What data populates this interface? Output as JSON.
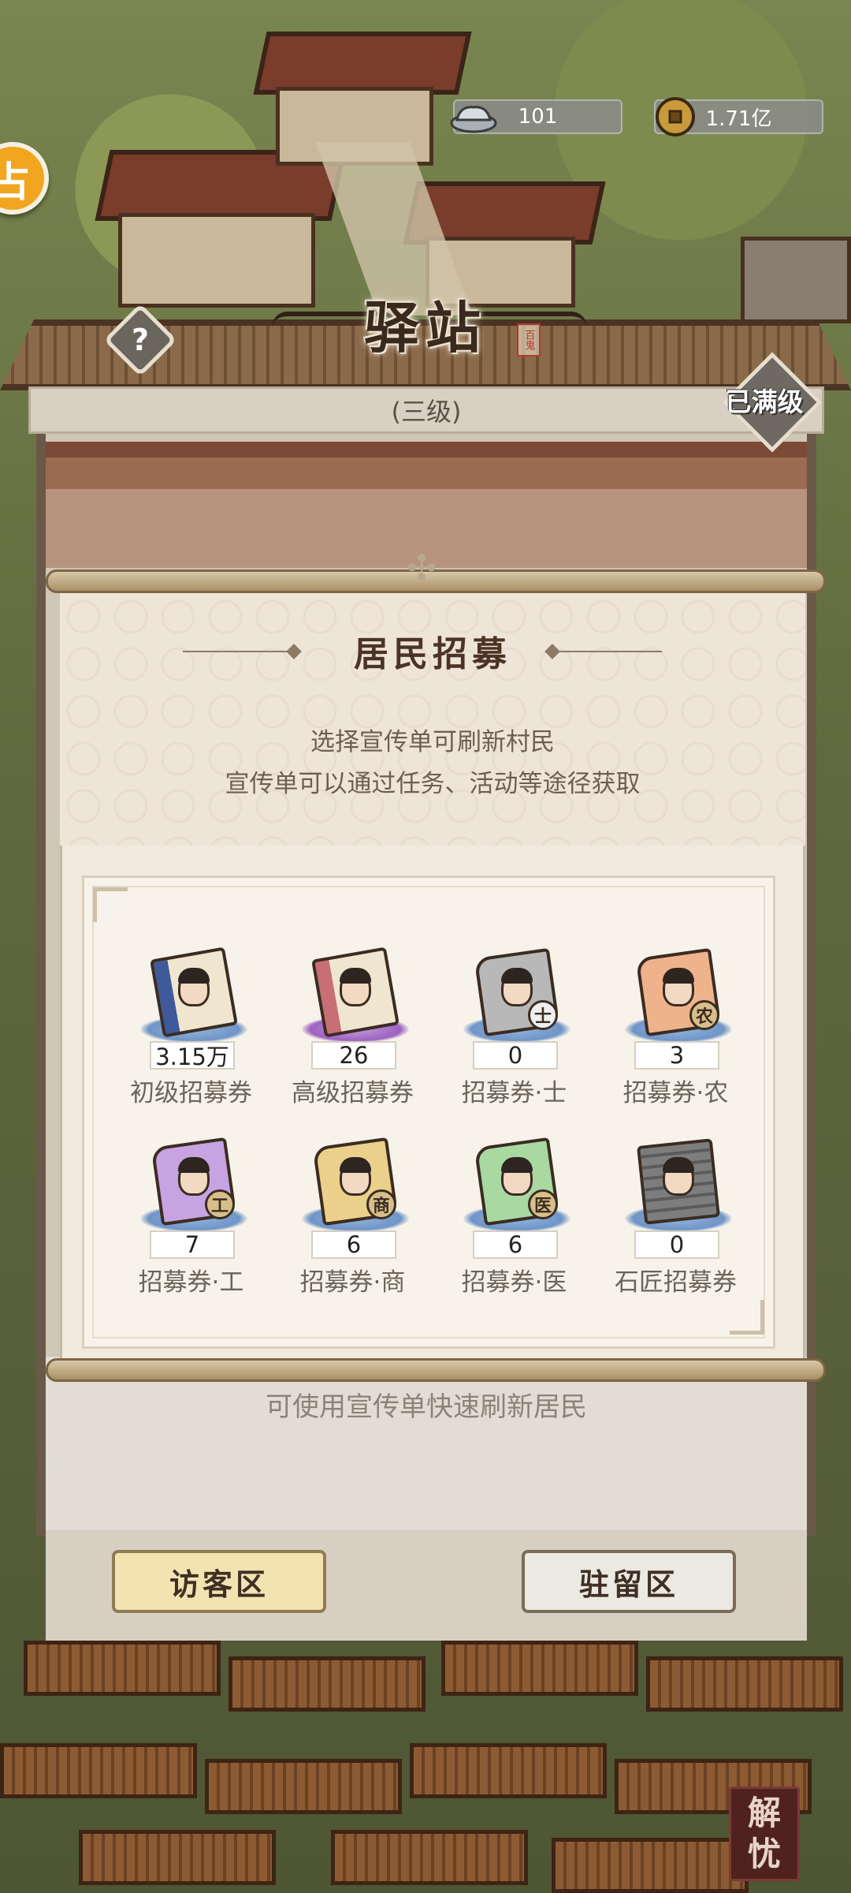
{
  "hud": {
    "silver_value": "101",
    "coin_value": "1.71亿",
    "silver_icon": "silver-ingot-icon",
    "coin_icon": "copper-coin-icon",
    "side_button_glyph": "占"
  },
  "building": {
    "title": "驿站",
    "seal_text": "百鬼",
    "level": "(三级)",
    "max_level_label": "已满级",
    "help_glyph": "?"
  },
  "popup": {
    "title": "居民招募",
    "desc_line1": "选择宣传单可刷新村民",
    "desc_line2": "宣传单可以通过任务、活动等途径获取",
    "items": [
      {
        "name": "初级招募券",
        "count": "3.15万",
        "badge": ""
      },
      {
        "name": "高级招募券",
        "count": "26",
        "badge": ""
      },
      {
        "name": "招募券·士",
        "count": "0",
        "badge": "士"
      },
      {
        "name": "招募券·农",
        "count": "3",
        "badge": "农"
      },
      {
        "name": "招募券·工",
        "count": "7",
        "badge": "工"
      },
      {
        "name": "招募券·商",
        "count": "6",
        "badge": "商"
      },
      {
        "name": "招募券·医",
        "count": "6",
        "badge": "医"
      },
      {
        "name": "石匠招募券",
        "count": "0",
        "badge": ""
      }
    ]
  },
  "footer": {
    "hint": "可使用宣传单快速刷新居民",
    "visitor_zone": "访客区",
    "stay_zone": "驻留区"
  },
  "corner_seal": {
    "char1": "解",
    "char2": "忧"
  }
}
